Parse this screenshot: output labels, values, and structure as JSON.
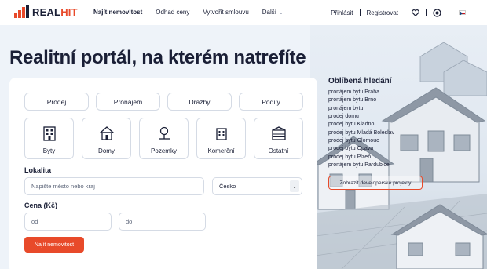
{
  "brand": {
    "name": "REAL",
    "name_accent": "HIT"
  },
  "nav": {
    "items": [
      "Najít nemovitost",
      "Odhad ceny",
      "Vytvořit smlouvu"
    ],
    "more": "Další"
  },
  "account": {
    "login": "Přihlásit",
    "register": "Registrovat"
  },
  "hero": {
    "title": "Realitní portál, na kterém natrefíte"
  },
  "search": {
    "types": [
      "Prodej",
      "Pronájem",
      "Dražby",
      "Podíly"
    ],
    "categories": [
      {
        "label": "Byty",
        "icon": "apartment-building-icon"
      },
      {
        "label": "Domy",
        "icon": "house-icon"
      },
      {
        "label": "Pozemky",
        "icon": "land-plot-icon"
      },
      {
        "label": "Komerční",
        "icon": "commercial-building-icon"
      },
      {
        "label": "Ostatní",
        "icon": "other-property-icon"
      }
    ],
    "location_label": "Lokalita",
    "location_placeholder": "Napište město nebo kraj",
    "country": "Česko",
    "price_label": "Cena (Kč)",
    "price_from_placeholder": "od",
    "price_to_placeholder": "do",
    "submit": "Najít nemovitost"
  },
  "favorites": {
    "title": "Oblíbená hledání",
    "items": [
      "pronájem bytu Praha",
      "pronájem bytu Brno",
      "pronájem bytu",
      "prodej domu",
      "prodej bytu Kladno",
      "prodej bytu Mladá Boleslav",
      "prodej bytu Olomouc",
      "prodej bytu Opava",
      "prodej bytu Plzeň",
      "pronájem bytu Pardubice"
    ],
    "developer_button": "Zobrazit developerské projekty"
  },
  "colors": {
    "accent": "#e84a2a",
    "text": "#1a1f36",
    "border": "#d5dbe5"
  }
}
